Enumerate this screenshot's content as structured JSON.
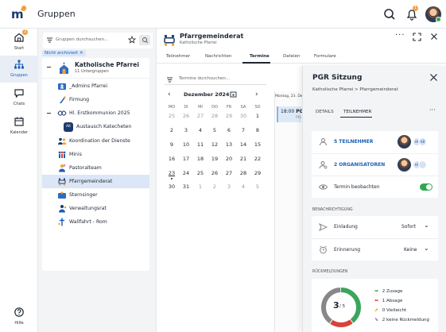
{
  "app": {
    "title": "Gruppen",
    "notification_count": "1"
  },
  "nav": {
    "start": {
      "label": "Start",
      "badge": "2"
    },
    "gruppen": {
      "label": "Gruppen"
    },
    "chats": {
      "label": "Chats"
    },
    "kalender": {
      "label": "Kalender"
    },
    "hilfe": {
      "label": "Hilfe"
    }
  },
  "groups": {
    "search_placeholder": "Gruppen durchsuchen...",
    "filter_chip": "Nicht archiviert ✕",
    "root": {
      "name": "Katholische Pfarrei",
      "sub": "11 Untergruppen"
    },
    "items": [
      {
        "label": "_Admins Pfarrei",
        "icon": "admins-icon"
      },
      {
        "label": "Firmung",
        "icon": "firmung-icon"
      },
      {
        "label": "Hl. Erstkommunion 2025",
        "icon": "erstkommunion-icon"
      },
      {
        "label": "Austausch Katecheten",
        "icon": "ak-avatar-icon",
        "avatar_text": "AK"
      },
      {
        "label": "Koordination der Dienste",
        "icon": "people-icon"
      },
      {
        "label": "Minis",
        "icon": "minis-icon"
      },
      {
        "label": "Pastoralteam",
        "icon": "pastoralteam-icon"
      },
      {
        "label": "Pfarrgemeinderat",
        "icon": "pfarrgemeinderat-icon"
      },
      {
        "label": "Sternsinger",
        "icon": "sternsinger-icon"
      },
      {
        "label": "Verwaltungsrat",
        "icon": "verwaltungsrat-icon"
      },
      {
        "label": "Wallfahrt - Rom",
        "icon": "wallfahrt-icon"
      }
    ]
  },
  "detail": {
    "title": "Pfarrgemeinderat",
    "subtitle": "Katholische Pfarrei",
    "tabs": [
      "Teilnehmer",
      "Nachrichten",
      "Termine",
      "Dateien",
      "Formulare"
    ],
    "active_tab": "Termine",
    "search_placeholder": "Termine durchsuchen...",
    "calendar": {
      "month_label": "Dezember 2024",
      "weekdays": [
        "MO",
        "DI",
        "MI",
        "DO",
        "FR",
        "SA",
        "SO"
      ],
      "weeks": [
        [
          "25",
          "26",
          "27",
          "28",
          "29",
          "30",
          "1"
        ],
        [
          "2",
          "3",
          "4",
          "5",
          "6",
          "7",
          "8"
        ],
        [
          "9",
          "10",
          "11",
          "12",
          "13",
          "14",
          "15"
        ],
        [
          "16",
          "17",
          "18",
          "19",
          "20",
          "21",
          "22"
        ],
        [
          "23",
          "24",
          "25",
          "26",
          "27",
          "28",
          "29"
        ],
        [
          "30",
          "31",
          "1",
          "2",
          "3",
          "4",
          "5"
        ]
      ]
    },
    "day_header": "Montag, 23. De",
    "event": {
      "time": "18:00",
      "title": "PG",
      "subtitle": "Pfa"
    }
  },
  "panel": {
    "title": "PGR Sitzung",
    "subtitle": "Katholische Pfarrei > Pfarrgemeinderat",
    "tabs": [
      "DETAILS",
      "TEILNEHMER"
    ],
    "active_tab": "TEILNEHMER",
    "participants": "5 TEILNEHMER",
    "organizers": "2 ORGANISATOREN",
    "watch_label": "Termin beobachten",
    "watch_enabled": true,
    "mini_avatars_1": [
      "AK",
      "AB"
    ],
    "mini_avatars_2": [
      "AB"
    ],
    "notification_section": "BENACHRICHTIGUNG",
    "invitation": {
      "label": "Einladung",
      "value": "Sofort"
    },
    "reminder": {
      "label": "Erinnerung",
      "value": "Keine"
    },
    "feedback_section": "RÜCKMELDUNGEN",
    "feedback": {
      "summary_count": "3",
      "summary_total": "/ 5",
      "rows": [
        {
          "label": "2 Zusage",
          "color": "#3aa55c"
        },
        {
          "label": "1 Absage",
          "color": "#d8423a"
        },
        {
          "label": "0 Vielleicht",
          "color": "#e2b320"
        },
        {
          "label": "2 keine Rückmeldung",
          "color": "#888888"
        }
      ]
    }
  },
  "colors": {
    "accent": "#1b5fb4",
    "brand_orange": "#f2a03d",
    "selected_bg": "#dbe7f6",
    "toggle_on": "#2fa84f"
  }
}
